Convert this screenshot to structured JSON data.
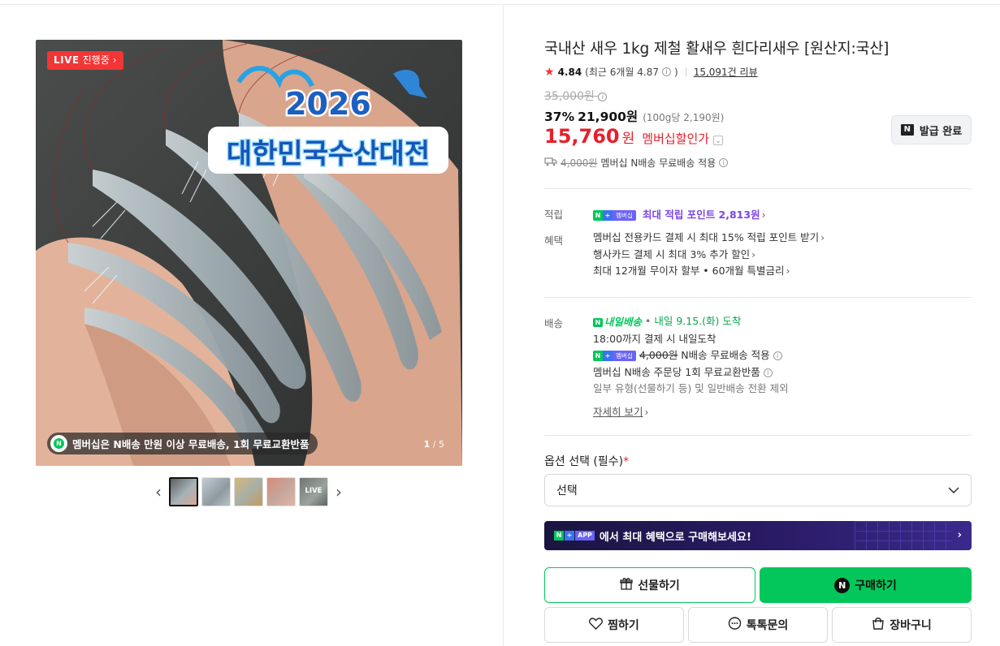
{
  "gallery": {
    "live_badge": "LIVE",
    "live_status": "진행중",
    "title_year": "2026",
    "title_text": "대한민국수산대전",
    "bottom_banner": "멤버십은 N배송 만원 이상 무료배송, 1회 무료교환반품",
    "counter_current": "1",
    "counter_total": "5",
    "thumbnails": [
      {
        "label": ""
      },
      {
        "label": ""
      },
      {
        "label": ""
      },
      {
        "label": ""
      },
      {
        "label": "LIVE"
      }
    ]
  },
  "product": {
    "title": "국내산 새우 1kg 제철 활새우 흰다리새우 [원산지:국산]",
    "rating_score": "4.84",
    "rating_recent": "(최근 6개월 4.87",
    "rating_recent_close": ")",
    "review_count": "15,091건 리뷰",
    "original_price": "35,000원",
    "discount_rate": "37%",
    "sale_price": "21,900원",
    "per_100g": "(100g당 2,190원)",
    "member_price": "15,760",
    "member_won": "원",
    "member_label": "멤버십할인가",
    "issue_button": "발급 완료",
    "ship_fee_strike": "4,000원",
    "ship_note": "멤버십 N배송 무료배송 적용"
  },
  "points": {
    "label": "적립",
    "text": "최대 적립 포인트 2,813원"
  },
  "benefits": {
    "label": "혜택",
    "items": [
      "멤버십 전용카드 결제 시 최대 15% 적립 포인트 받기",
      "행사카드 결제 시 최대 3% 추가 할인",
      "최대 12개월 무이자 할부 • 60개월 특별금리"
    ]
  },
  "delivery": {
    "label": "배송",
    "tomorrow_logo": "내일배송",
    "arrival": "내일 9.15.(화) 도착",
    "cutoff": "18:00까지 결제 시 내일도착",
    "fee_strike": "4,000원",
    "fee_note": "N배송 무료배송 적용",
    "exchange": "멤버십 N배송 주문당 1회 무료교환반품",
    "exception": "일부 유형(선물하기 등) 및 일반배송 전환 제외",
    "detail_link": "자세히 보기"
  },
  "options": {
    "label": "옵션 선택 (필수)",
    "required_mark": "*",
    "selected": "선택"
  },
  "app_banner": {
    "badge_app": "APP",
    "text": "에서 최대 혜택으로 구매해보세요!"
  },
  "buttons": {
    "gift": "선물하기",
    "buy": "구매하기",
    "wish": "찜하기",
    "talk": "톡톡문의",
    "cart": "장바구니"
  },
  "membership_pill": "멤버십",
  "colors": {
    "naver_green": "#03c75a",
    "discount_red": "#e5202c",
    "points_purple": "#7a46e8"
  }
}
